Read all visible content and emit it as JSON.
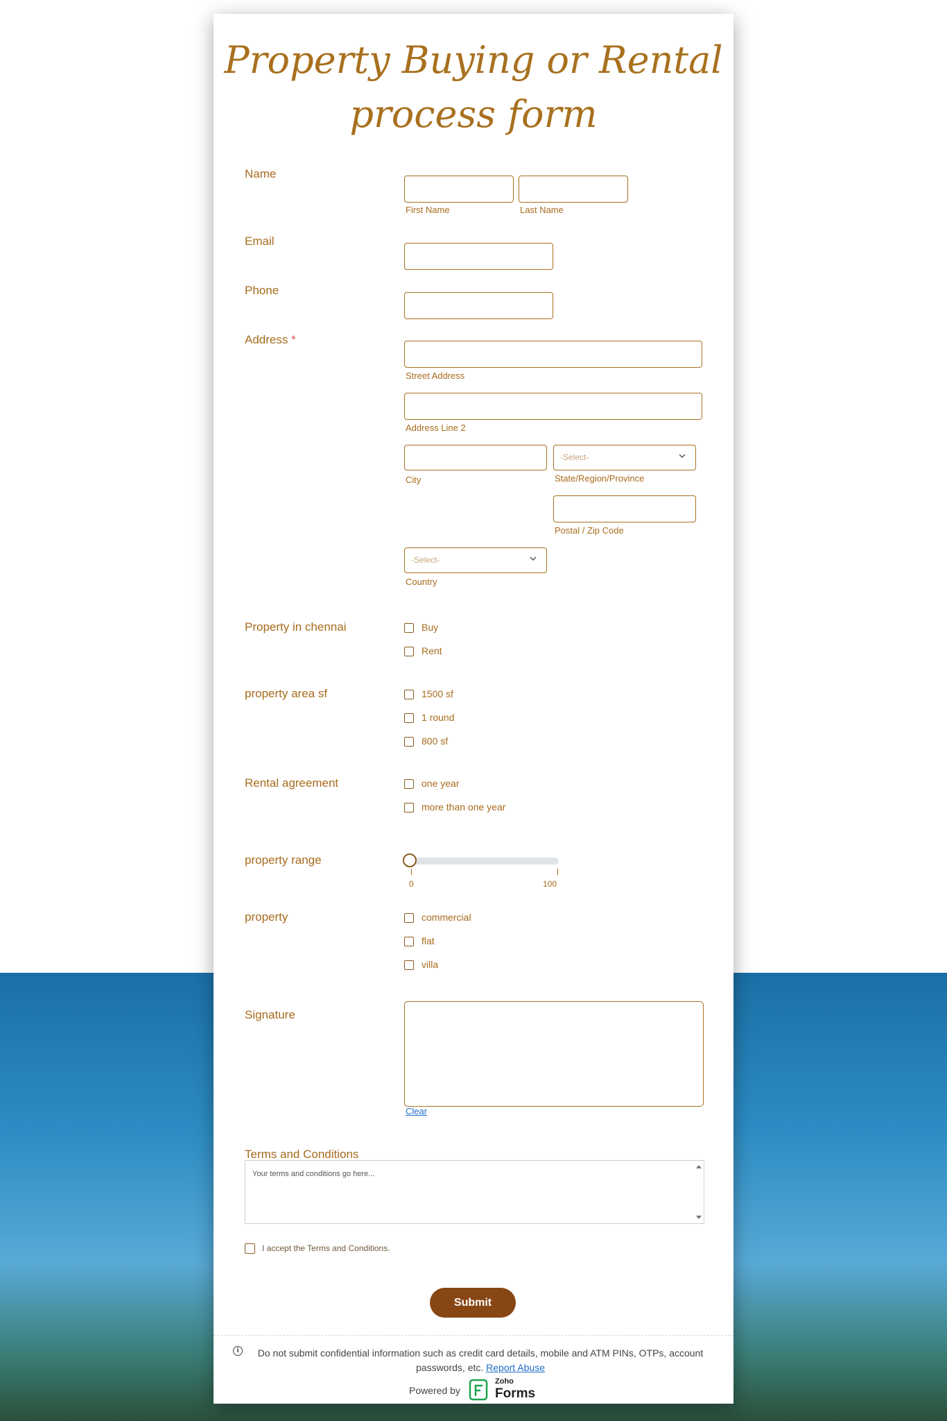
{
  "form": {
    "title_line1": "Property Buying or Rental",
    "title_line2": "process form"
  },
  "fields": {
    "name": {
      "label": "Name",
      "first_sub": "First Name",
      "last_sub": "Last Name",
      "first_value": "",
      "last_value": ""
    },
    "email": {
      "label": "Email",
      "value": ""
    },
    "phone": {
      "label": "Phone",
      "value": ""
    },
    "address": {
      "label": "Address",
      "required_mark": "*",
      "street_sub": "Street Address",
      "line2_sub": "Address Line 2",
      "city_sub": "City",
      "state_placeholder": "-Select-",
      "state_sub": "State/Region/Province",
      "postal_sub": "Postal / Zip Code",
      "country_placeholder": "-Select-",
      "country_sub": "Country"
    },
    "property_chennai": {
      "label": "Property in chennai",
      "options": [
        "Buy",
        "Rent"
      ]
    },
    "property_area": {
      "label": "property area sf",
      "options": [
        "1500 sf",
        "1 round",
        "800 sf"
      ]
    },
    "rental_agreement": {
      "label": "Rental agreement",
      "options": [
        "one year",
        "more than one year"
      ]
    },
    "property_range": {
      "label": "property range",
      "min_label": "0",
      "max_label": "100",
      "value": 0
    },
    "property": {
      "label": "property",
      "options": [
        "commercial",
        "flat",
        "villa"
      ]
    },
    "signature": {
      "label": "Signature",
      "clear_label": "Clear"
    },
    "terms": {
      "label": "Terms and Conditions",
      "text": "Your terms and conditions go here...",
      "accept_label": "I accept the Terms and Conditions."
    }
  },
  "submit_label": "Submit",
  "footer": {
    "disclaimer": "Do not submit confidential information such as credit card details, mobile and ATM PINs, OTPs, account passwords, etc.",
    "report_link": "Report Abuse",
    "powered_by": "Powered by",
    "brand_top": "Zoho",
    "brand_main": "Forms"
  },
  "colors": {
    "accent": "#a8701e",
    "submit_bg": "#874614",
    "link": "#1f6fc9"
  }
}
